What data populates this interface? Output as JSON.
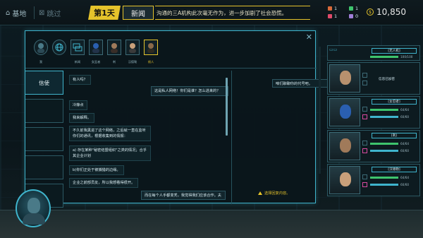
{
  "topbar": {
    "base_label": "基地",
    "skip_label": "跳过",
    "day_label": "第1天",
    "news_label": "新闻",
    "ticker_text": "沟通的三A机构此次毫无作为，进一步加剧了社会恐慌。",
    "resources": [
      {
        "value": "1",
        "color": "#d86a3a"
      },
      {
        "value": "1",
        "color": "#e04a6a"
      },
      {
        "value": "1",
        "color": "#3ec46d"
      },
      {
        "value": "0",
        "color": "#9f7fd8"
      }
    ],
    "money": "10,850"
  },
  "dialog": {
    "close_label": "✕",
    "contacts": [
      {
        "name": "我",
        "selected": false
      },
      {
        "name": "",
        "selected": false
      },
      {
        "name": "新闻",
        "selected": false
      },
      {
        "name": "女巫者",
        "selected": false
      },
      {
        "name": "刺",
        "selected": false
      },
      {
        "name": "汉德勒",
        "selected": false
      },
      {
        "name": "线人",
        "selected": true
      }
    ],
    "tabs": [
      {
        "label": "信使",
        "active": true
      },
      {
        "label": "",
        "active": false
      },
      {
        "label": "",
        "active": false
      },
      {
        "label": "",
        "active": false
      },
      {
        "label": "",
        "active": false
      }
    ],
    "messages": [
      "有人吗？",
      "这是私人网络！你们是谁？怎么进来的？",
      "冷静点",
      "我来解释。",
      "不久前我黑进了这个网络，之后就一直在监听你们的通讯，根据收集到的情报：",
      "a) 存在某种\"秘密结盟组织\"之类的情况；合乎其企业计划",
      "b)你们正处于被捕猎的边缘。",
      "企业之前部员友，所以我想看得很开。",
      "而在每个人手都变秃，我觉得我们应该合作。夫"
    ],
    "reply": "咱们聊聊你的代号吧。",
    "choose_label": "选择回复内容。"
  },
  "roster": [
    {
      "name": "[无人机]",
      "stat_a": "100/100",
      "special": ""
    },
    {
      "name": "",
      "stat_a": "",
      "special": "信息已加密"
    },
    {
      "name": "[女忍者]",
      "stat_a": "64/64",
      "stat_b": "60/60"
    },
    {
      "name": "[刺]",
      "stat_a": "64/64",
      "stat_b": "60/60"
    },
    {
      "name": "[汉德勒]",
      "stat_a": "64/64",
      "stat_b": "60/60"
    }
  ],
  "colors": {
    "accent": "#3fb4cc",
    "highlight": "#e5c32b",
    "health": "#3ec46d"
  },
  "icons": {
    "base": "home-icon",
    "skip": "skip-icon",
    "money": "currency-icon",
    "close": "close-icon",
    "warn": "warning-icon"
  }
}
